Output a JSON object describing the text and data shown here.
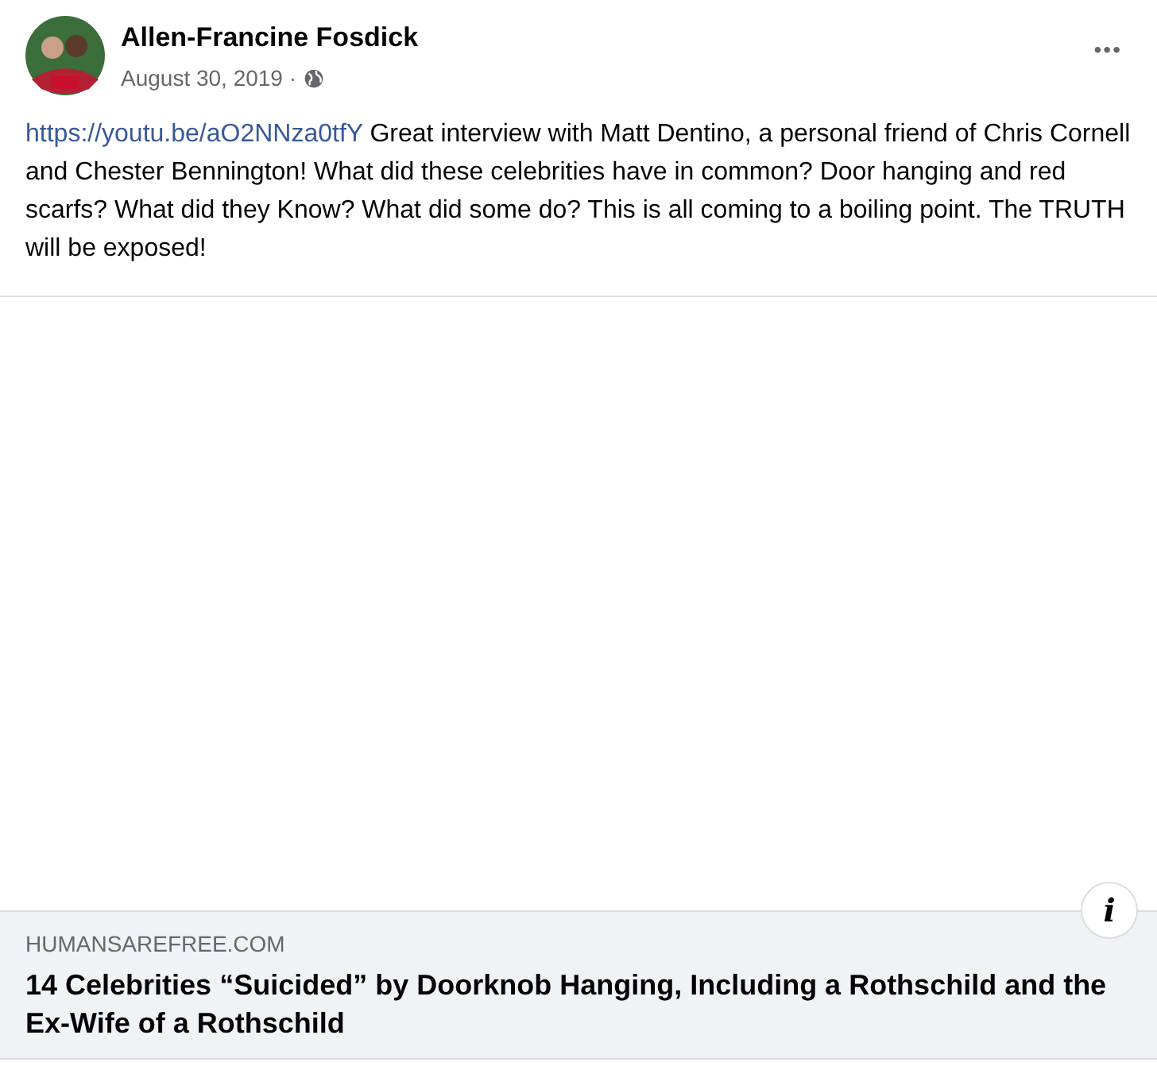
{
  "post": {
    "author": "Allen-Francine Fosdick",
    "date": "August 30, 2019 ·",
    "menu": "•••",
    "link": "https://youtu.be/aO2NNza0tfY",
    "message": " Great interview with Matt Dentino, a personal friend of Chris Cornell and Chester Bennington! What did these celebrities have in common? Door hanging and red scarfs? What did they Know? What did some do? This is all coming to a boiling point. The TRUTH will be exposed!"
  },
  "preview": {
    "info": "i",
    "domain": "HUMANSAREFREE.COM",
    "title": "14 Celebrities “Suicided” by Doorknob Hanging, Including a Rothschild and the Ex-Wife of a Rothschild"
  }
}
